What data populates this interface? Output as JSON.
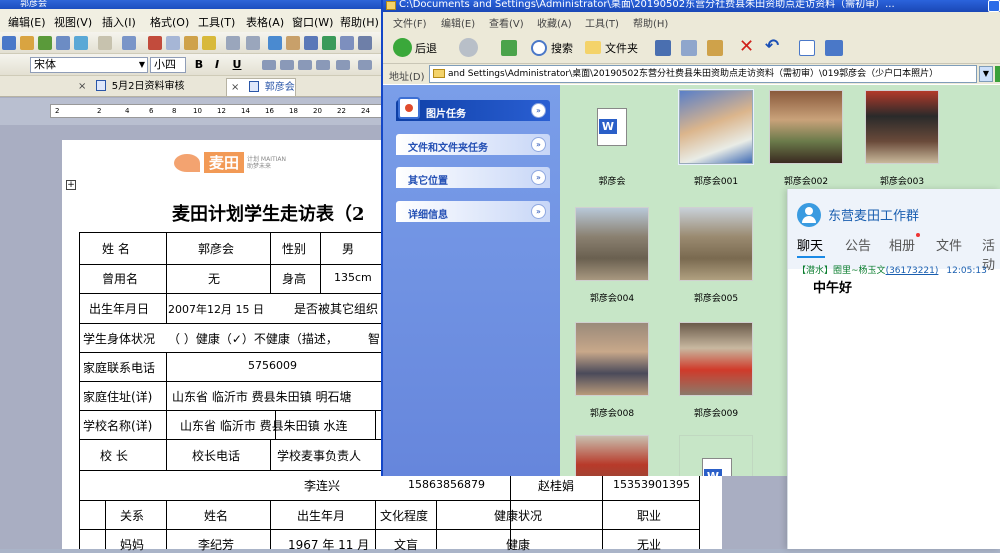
{
  "word": {
    "title": "郭彦会",
    "menu": [
      "编辑(E)",
      "视图(V)",
      "插入(I)",
      "格式(O)",
      "工具(T)",
      "表格(A)",
      "窗口(W)",
      "帮助(H)"
    ],
    "font_name": "宋体",
    "font_size": "小四",
    "fmt": {
      "bold": "B",
      "italic": "I",
      "underline": "U"
    },
    "tabs": [
      {
        "label": "5月2日资料审核",
        "close": "×"
      },
      {
        "label": "郭彦会",
        "close": "×"
      }
    ],
    "ruler": [
      "2",
      "2",
      "4",
      "6",
      "8",
      "10",
      "12",
      "14",
      "16",
      "18",
      "20",
      "22",
      "24"
    ],
    "logo": {
      "text": "麦田",
      "small": "计划 MAITIAN 助梦未来"
    },
    "doc_title": "麦田计划学生走访表（2",
    "form": {
      "name_label": "姓  名",
      "name_value": "郭彦会",
      "gender_label": "性别",
      "gender_value": "男",
      "former_name_label": "曾用名",
      "former_name_value": "无",
      "height_label": "身高",
      "height_value": "135cm",
      "birth_label": "出生年月日",
      "birth_value": "2007年12月 15 日",
      "other_org_label": "是否被其它组织",
      "health_label": "学生身体状况",
      "health_value": "（  ）健康（✓）不健康（描述，",
      "health_extra": "智",
      "phone_label": "家庭联系电话",
      "phone_value": "5756009",
      "address_label": "家庭住址(详)",
      "address_value": "山东省 临沂市 费县朱田镇 明石塘",
      "school_label": "学校名称(详)",
      "school_value": "山东省 临沂市 费县朱田镇 水连",
      "principal_label": "校    长",
      "principal_phone_label": "校长电话",
      "funding_label": "学校麦事负责人",
      "contact1_name": "李连兴",
      "contact1_phone": "15863856879",
      "contact2_name": "赵桂娟",
      "contact2_phone": "15353901395",
      "family_headers": [
        "关系",
        "姓名",
        "出生年月",
        "文化程度",
        "健康状况",
        "职业"
      ],
      "family_row": [
        "妈妈",
        "李纪芳",
        "1967 年 11 月",
        "文盲",
        "健康",
        "无业"
      ]
    }
  },
  "explorer": {
    "title": "C:\\Documents and Settings\\Administrator\\桌面\\20190502东营分社费县朱田资助点走访资料（需初审）...",
    "menu": [
      "文件(F)",
      "编辑(E)",
      "查看(V)",
      "收藏(A)",
      "工具(T)",
      "帮助(H)"
    ],
    "toolbar": {
      "back": "后退",
      "search": "搜索",
      "folders": "文件夹"
    },
    "address_label": "地址(D)",
    "address_value": "and Settings\\Administrator\\桌面\\20190502东营分社费县朱田资助点走访资料（需初审）\\019郭彦会（少户口本照片）",
    "panels": [
      "图片任务",
      "文件和文件夹任务",
      "其它位置",
      "详细信息"
    ],
    "files": [
      "郭彦会",
      "郭彦会001",
      "郭彦会002",
      "郭彦会003",
      "郭彦会004",
      "郭彦会005",
      "郭彦会008",
      "郭彦会009"
    ]
  },
  "qq": {
    "group_name": "东营麦田工作群",
    "tabs": [
      "聊天",
      "公告",
      "相册",
      "文件",
      "活动"
    ],
    "msg_prefix": "【潜水】",
    "msg_sender": "圈里~杨玉文",
    "msg_qq": "(36173221)",
    "msg_time": "12:05:13",
    "msg_text": "中午好"
  },
  "colors": {
    "xp_blue": "#1a47b5",
    "explorer_bg": "#c7e6c7",
    "qq_link": "#1a5fb0",
    "logo_orange": "#f29a56"
  }
}
